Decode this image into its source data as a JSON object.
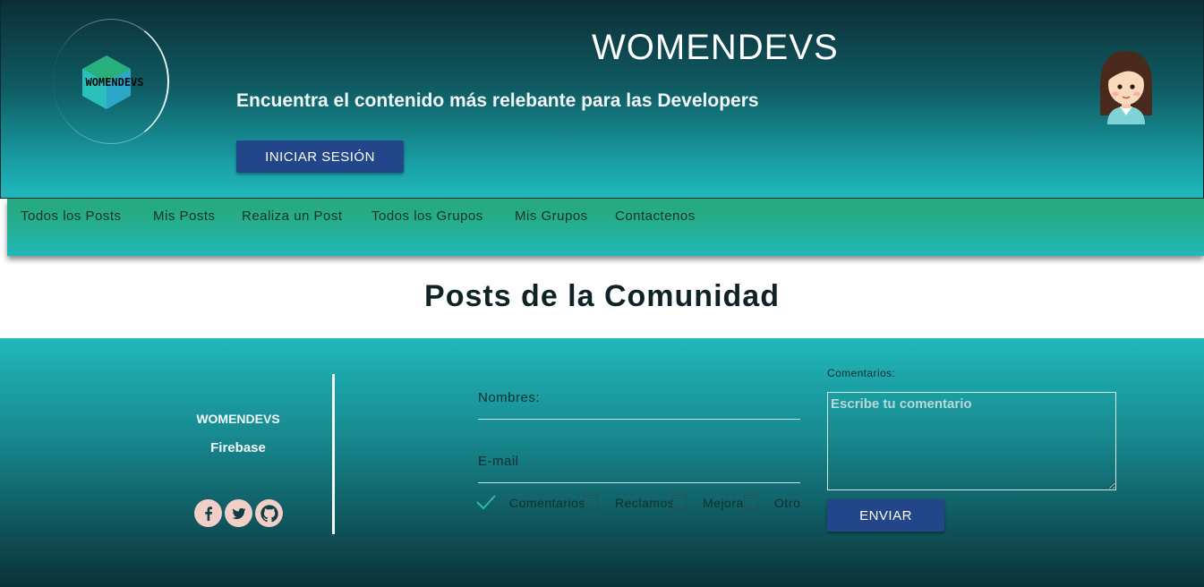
{
  "header": {
    "logo_text": "WOMENDEVS",
    "site_title": "WOMENDEVS",
    "tagline": "Encuentra el contenido más relebante para las Developers",
    "login_label": "INICIAR SESIÓN"
  },
  "nav": {
    "items": [
      {
        "label": "Todos los Posts"
      },
      {
        "label": "Mis Posts"
      },
      {
        "label": "Realiza un Post"
      },
      {
        "label": "Todos los Grupos"
      },
      {
        "label": "Mis Grupos"
      },
      {
        "label": "Contactenos"
      }
    ]
  },
  "main": {
    "section_title": "Posts de la Comunidad"
  },
  "footer": {
    "brand": "WOMENDEVS",
    "tech": "Firebase",
    "social_icons": [
      "facebook-icon",
      "twitter-icon",
      "github-icon"
    ],
    "form": {
      "name_label": "Nombres:",
      "email_label": "E-mail",
      "checkboxes": [
        {
          "label": "Comentarios",
          "checked": true
        },
        {
          "label": "Reclamos",
          "checked": false
        },
        {
          "label": "Mejora",
          "checked": false
        },
        {
          "label": "Otro",
          "checked": false
        }
      ],
      "comments_label": "Comentarios:",
      "comments_placeholder": "Escribe tu comentario",
      "submit_label": "ENVIAR"
    }
  },
  "colors": {
    "button": "#23468a",
    "header_top": "#0c2e36",
    "teal": "#1fb8bb",
    "nav_green": "#27a87d",
    "social_bg": "#f2cfc6"
  }
}
